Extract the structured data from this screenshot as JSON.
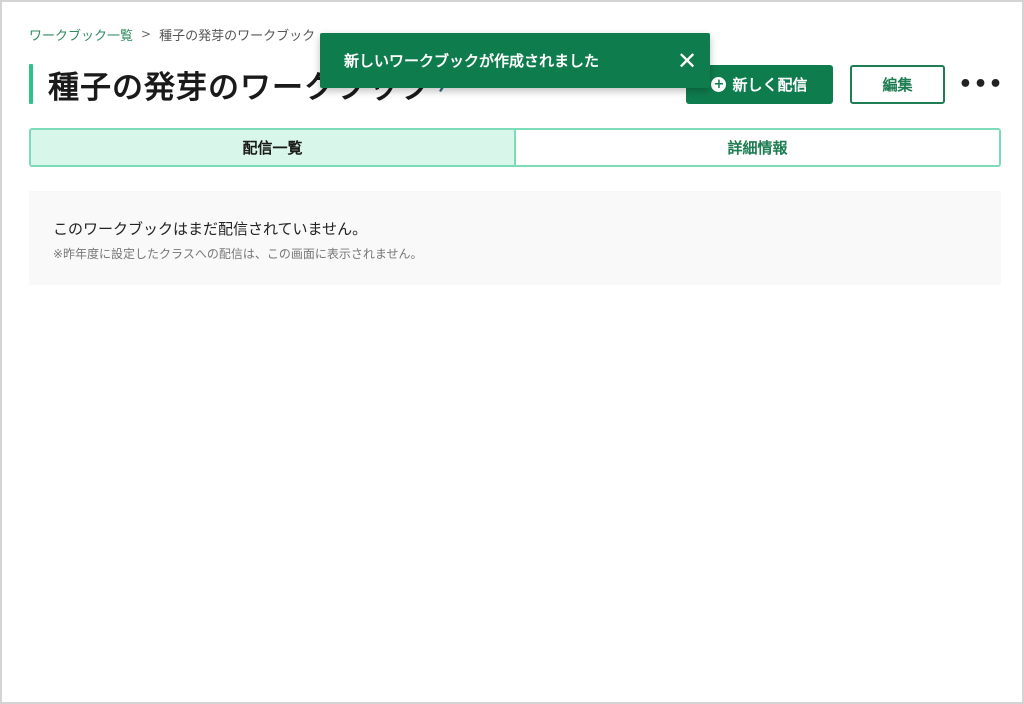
{
  "breadcrumb": {
    "parent_label": "ワークブック一覧",
    "separator": ">",
    "current_label": "種子の発芽のワークブック"
  },
  "header": {
    "title": "種子の発芽のワークブック",
    "edit_title_icon": "pencil-icon",
    "new_delivery_label": "新しく配信",
    "new_delivery_icon": "plus-circle-icon",
    "edit_label": "編集",
    "more_label": "•••"
  },
  "tabs": [
    {
      "label": "配信一覧",
      "active": true
    },
    {
      "label": "詳細情報",
      "active": false
    }
  ],
  "empty_state": {
    "message": "このワークブックはまだ配信されていません。",
    "note": "※昨年度に設定したクラスへの配信は、この画面に表示されません。"
  },
  "toast": {
    "message": "新しいワークブックが作成されました",
    "close_icon": "close-icon"
  },
  "colors": {
    "primary": "#0f7c4e",
    "accent": "#2ec28b",
    "tab_active_bg": "#d9f6ea",
    "tab_border": "#7ddcb8"
  }
}
